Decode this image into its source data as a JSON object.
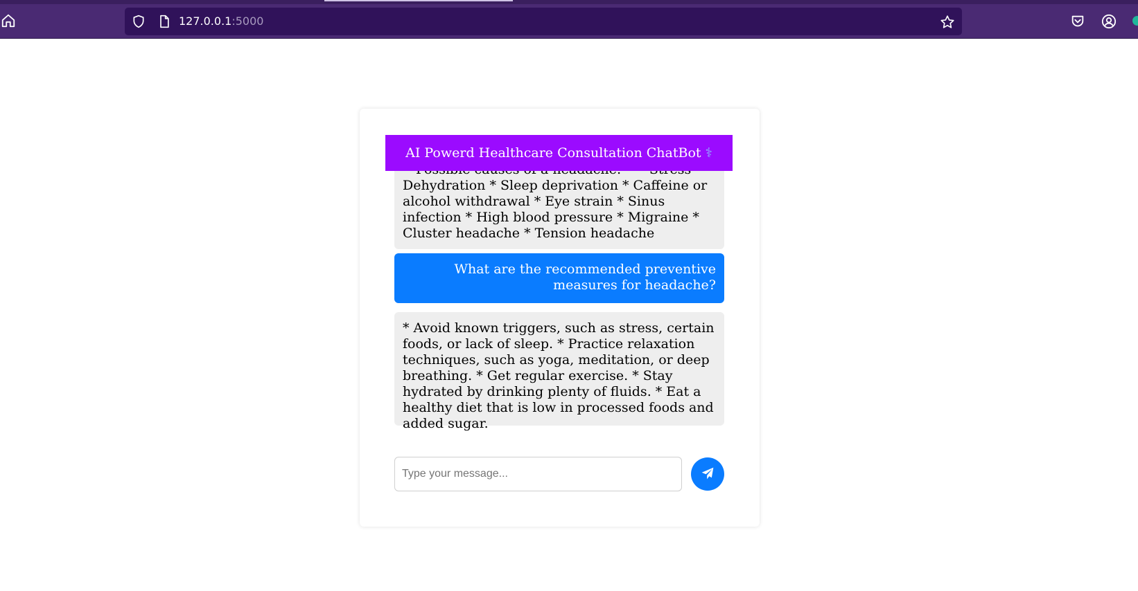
{
  "browser": {
    "url_host": "127.0.0.1",
    "url_port": ":5000",
    "icons": {
      "home": "home-icon",
      "shield": "shield-icon",
      "page": "page-icon",
      "bookmark": "star-icon",
      "pocket": "pocket-icon",
      "account": "account-icon"
    }
  },
  "chat": {
    "title": "AI Powerd Healthcare Consultation ChatBot",
    "title_icon": "⚕",
    "messages": [
      {
        "role": "bot",
        "text": "**Possible causes of a headache:** * Stress * Dehydration * Sleep deprivation * Caffeine or alcohol withdrawal * Eye strain * Sinus infection * High blood pressure * Migraine * Cluster headache * Tension headache"
      },
      {
        "role": "user",
        "text": "What are the recommended preventive measures for headache?"
      },
      {
        "role": "bot",
        "text": "* Avoid known triggers, such as stress, certain foods, or lack of sleep. * Practice relaxation techniques, such as yoga, meditation, or deep breathing. * Get regular exercise. * Stay hydrated by drinking plenty of fluids. * Eat a healthy diet that is low in processed foods and added sugar."
      }
    ],
    "input": {
      "placeholder": "Type your message...",
      "value": ""
    },
    "send_icon": "paper-plane-icon"
  },
  "colors": {
    "browser_bg": "#4a2a73",
    "urlbar_bg": "#30125a",
    "header_bg": "#9b0bff",
    "user_bubble": "#0a7cff",
    "bot_bubble": "#eeeeee",
    "send_button": "#0a7cff"
  }
}
